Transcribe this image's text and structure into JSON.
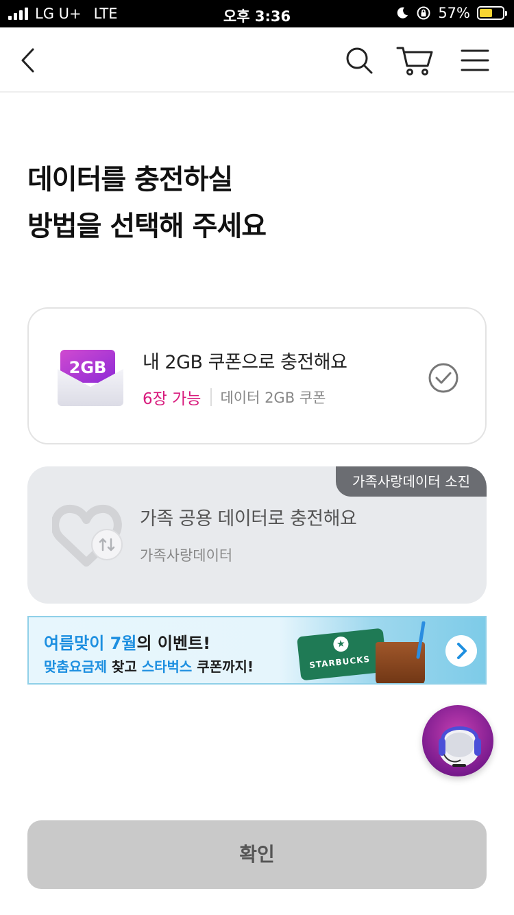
{
  "status_bar": {
    "carrier": "LG U+",
    "network": "LTE",
    "time": "오후 3:36",
    "battery": "57%",
    "battery_level": 0.57
  },
  "header": {
    "icons": [
      "back-icon",
      "search-icon",
      "cart-icon",
      "menu-icon"
    ]
  },
  "title": {
    "line1": "데이터를 충전하실",
    "line2": "방법을 선택해 주세요"
  },
  "options": [
    {
      "icon_text": "2GB",
      "name": "내 2GB 쿠폰으로 충전해요",
      "count": "6장 가능",
      "desc": "데이터 2GB 쿠폰",
      "selected": true
    },
    {
      "badge": "가족사랑데이터 소진",
      "name": "가족 공용 데이터로 충전해요",
      "desc": "가족사랑데이터",
      "disabled": true
    }
  ],
  "banner": {
    "line1_a": "여름맞이 7월",
    "line1_b": "의 이벤트!",
    "line2_a": "맞춤요금제",
    "line2_b": " 찾고 ",
    "line2_c": "스타벅스",
    "line2_d": " 쿠폰까지!",
    "card_brand": "STARBUCKS"
  },
  "confirm_button": "확인",
  "colors": {
    "accent_pink": "#d81b7d",
    "banner_blue": "#1d8fe0",
    "disabled_button": "#c9c9c9"
  }
}
